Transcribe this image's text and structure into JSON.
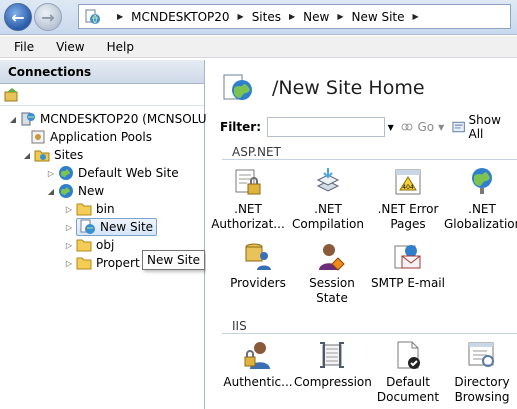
{
  "address": {
    "crumbs": [
      "MCNDESKTOP20",
      "Sites",
      "New",
      "New Site"
    ]
  },
  "menu": [
    "File",
    "View",
    "Help"
  ],
  "connections": {
    "title": "Connections",
    "tree": [
      {
        "label": "MCNDESKTOP20 (MCNSOLU",
        "icon": "server-icon"
      },
      {
        "label": "Application Pools",
        "icon": "app-pools-icon"
      },
      {
        "label": "Sites",
        "icon": "sites-folder-icon"
      },
      {
        "label": "Default Web Site",
        "icon": "globe-icon"
      },
      {
        "label": "New",
        "icon": "globe-icon"
      },
      {
        "label": "bin",
        "icon": "folder-icon"
      },
      {
        "label": "New Site",
        "icon": "site-icon"
      },
      {
        "label": "obj",
        "icon": "folder-icon"
      },
      {
        "label": "Propert",
        "icon": "folder-icon"
      }
    ],
    "tooltip": "New Site"
  },
  "main": {
    "title": "/New Site Home",
    "filter": {
      "label": "Filter:",
      "value": "",
      "go": "Go",
      "show_all": "Show All"
    },
    "sections": [
      {
        "name": "ASP.NET",
        "features": [
          {
            "label": ".NET Authorizat...",
            "icon": "authorization-icon"
          },
          {
            "label": ".NET Compilation",
            "icon": "compilation-icon"
          },
          {
            "label": ".NET Error Pages",
            "icon": "error-pages-icon"
          },
          {
            "label": ".NET Globalization",
            "icon": "globalization-icon"
          },
          {
            "label": "Providers",
            "icon": "providers-icon"
          },
          {
            "label": "Session State",
            "icon": "session-state-icon"
          },
          {
            "label": "SMTP E-mail",
            "icon": "smtp-email-icon"
          }
        ]
      },
      {
        "name": "IIS",
        "features": [
          {
            "label": "Authentic...",
            "icon": "authentication-icon"
          },
          {
            "label": "Compression",
            "icon": "compression-icon"
          },
          {
            "label": "Default Document",
            "icon": "default-document-icon"
          },
          {
            "label": "Directory Browsing",
            "icon": "directory-browsing-icon"
          }
        ]
      }
    ]
  }
}
